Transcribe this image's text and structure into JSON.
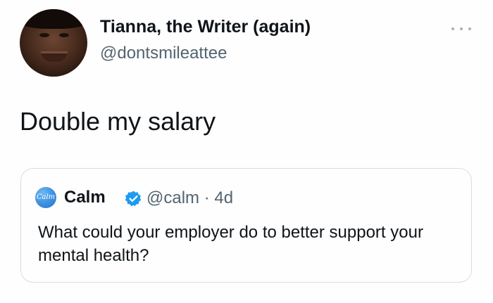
{
  "author": {
    "display_name": "Tianna, the Writer (again)",
    "handle": "@dontsmileattee"
  },
  "tweet": {
    "text": "Double my salary"
  },
  "quoted_tweet": {
    "logo_text": "Calm",
    "display_name": "Calm",
    "meta": "@calm · 4d",
    "text": "What could your employer do to better support your mental health?"
  },
  "icons": {
    "more": "more-horizontal-icon",
    "verified": "verified-badge-icon"
  },
  "colors": {
    "text": "#0f1419",
    "secondary_text": "#536471",
    "border": "#d7dde2",
    "verified_blue": "#1d9bf0",
    "calm_blue": "#3b8fe0"
  }
}
